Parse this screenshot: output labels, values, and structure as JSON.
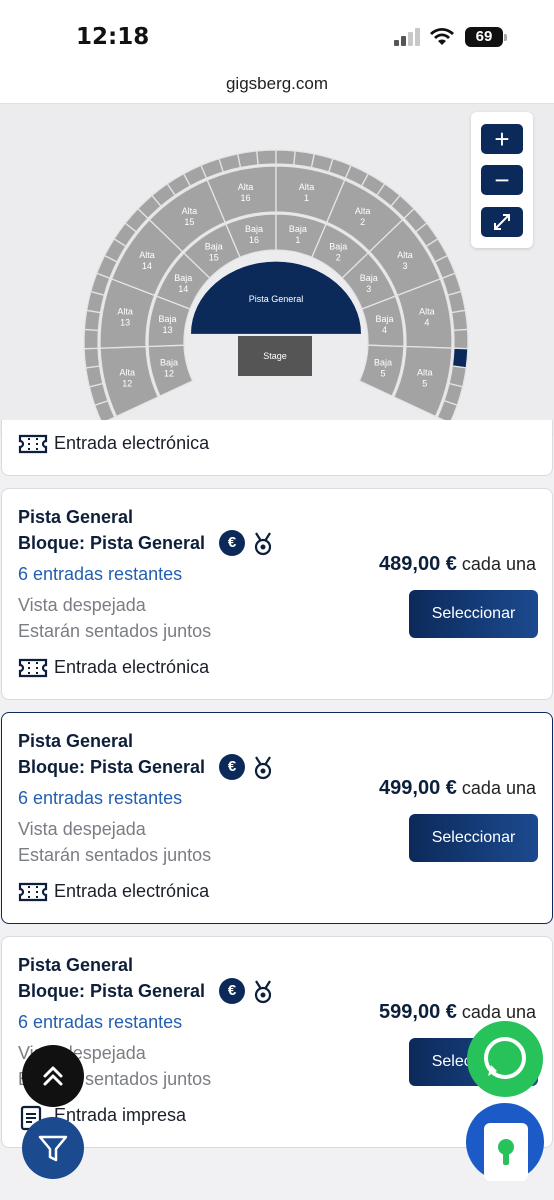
{
  "status_bar": {
    "time": "12:18",
    "battery": "69"
  },
  "url_bar": {
    "domain": "gigsberg.com"
  },
  "map": {
    "stage_label": "Stage",
    "floor_label": "Pista General",
    "controls": [
      "zoom-in",
      "zoom-out",
      "fullscreen"
    ],
    "highlight_color": "#0b2a5a",
    "section_color": "#a3a3a3",
    "upper_sections": [
      {
        "name": "Alta",
        "num": "16"
      },
      {
        "name": "Alta",
        "num": "1"
      },
      {
        "name": "Alta",
        "num": "2"
      },
      {
        "name": "Alta",
        "num": "3"
      },
      {
        "name": "Alta",
        "num": "4"
      },
      {
        "name": "Alta",
        "num": "5"
      },
      {
        "name": "Alta",
        "num": "15"
      },
      {
        "name": "Alta",
        "num": "14"
      },
      {
        "name": "Alta",
        "num": "13"
      },
      {
        "name": "Alta",
        "num": "12"
      }
    ],
    "lower_sections": [
      {
        "name": "Baja",
        "num": "16"
      },
      {
        "name": "Baja",
        "num": "1"
      },
      {
        "name": "Baja",
        "num": "2"
      },
      {
        "name": "Baja",
        "num": "3"
      },
      {
        "name": "Baja",
        "num": "4"
      },
      {
        "name": "Baja",
        "num": "5"
      },
      {
        "name": "Baja",
        "num": "15"
      },
      {
        "name": "Baja",
        "num": "14"
      },
      {
        "name": "Baja",
        "num": "13"
      },
      {
        "name": "Baja",
        "num": "12"
      }
    ]
  },
  "partial_card": {
    "delivery": "Entrada electrónica"
  },
  "listings": [
    {
      "title": "Pista General",
      "block": "Bloque: Pista General",
      "euro_badge": "€",
      "remaining": "6 entradas restantes",
      "feature_1": "Vista despejada",
      "feature_2": "Estarán sentados juntos",
      "price": "489,00 €",
      "price_suffix": "cada una",
      "button": "Seleccionar",
      "delivery": "Entrada electrónica"
    },
    {
      "title": "Pista General",
      "block": "Bloque: Pista General",
      "euro_badge": "€",
      "remaining": "6 entradas restantes",
      "feature_1": "Vista despejada",
      "feature_2": "Estarán sentados juntos",
      "price": "499,00 €",
      "price_suffix": "cada una",
      "button": "Seleccionar",
      "delivery": "Entrada electrónica"
    },
    {
      "title": "Pista General",
      "block": "Bloque: Pista General",
      "euro_badge": "€",
      "remaining": "6 entradas restantes",
      "feature_1": "Vista despejada",
      "feature_2": "Estarán sentados juntos",
      "price": "599,00 €",
      "price_suffix": "cada una",
      "button": "Seleccionar",
      "delivery": "Entrada impresa"
    }
  ],
  "colors": {
    "brand": "#0b2a5a",
    "link": "#2360b0",
    "whatsapp": "#27c35a"
  }
}
